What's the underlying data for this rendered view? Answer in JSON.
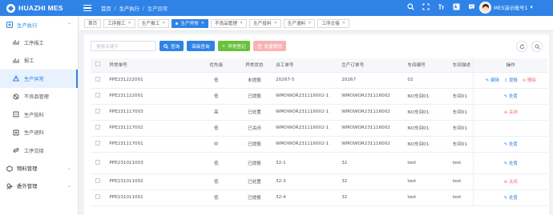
{
  "app": {
    "name": "HUAZHI MES"
  },
  "breadcrumb": [
    "首页",
    "生产执行",
    "生产异常"
  ],
  "header_icons": [
    "search-icon",
    "fullscreen-icon",
    "font-size-icon",
    "translate-icon",
    "message-icon"
  ],
  "user": {
    "name": "MES演示账号1",
    "dropdown": "▾"
  },
  "sidebar": {
    "group": {
      "label": "生产执行",
      "chev": "⌃"
    },
    "items": [
      {
        "label": "工序报工",
        "icon": "report-icon"
      },
      {
        "label": "报工",
        "icon": "report-icon"
      },
      {
        "label": "生产异常",
        "icon": "warning-icon",
        "active": true
      },
      {
        "label": "不良品管理",
        "icon": "bad-product-icon"
      },
      {
        "label": "生产投料",
        "icon": "feed-icon"
      },
      {
        "label": "生产退料",
        "icon": "return-icon"
      },
      {
        "label": "工序交接",
        "icon": "handover-icon"
      }
    ],
    "groups_after": [
      {
        "label": "物料管理",
        "chev": "⌄"
      },
      {
        "label": "委外管理",
        "chev": "⌄"
      }
    ]
  },
  "tabs": [
    {
      "label": "首页",
      "closable": false
    },
    {
      "label": "工序报工",
      "closable": true
    },
    {
      "label": "生产报工",
      "closable": true
    },
    {
      "label": "生产异常",
      "closable": true,
      "active": true
    },
    {
      "label": "不良品管理",
      "closable": true
    },
    {
      "label": "生产投料",
      "closable": true
    },
    {
      "label": "生产退料",
      "closable": true
    },
    {
      "label": "工序交接",
      "closable": true
    }
  ],
  "toolbar": {
    "search_placeholder": "搜索关键字",
    "query": "查询",
    "advanced": "高级查询",
    "add": "异常登记",
    "batch_delete": "批量删除"
  },
  "table": {
    "columns": [
      "异常单号",
      "优先级",
      "异常状态",
      "派工单号",
      "生产订单号",
      "车间编号",
      "车间描述",
      "操作"
    ],
    "rows": [
      {
        "no": "PPE231222001",
        "priority": "低",
        "status": "未提报",
        "dispatch": "20267-5",
        "order": "20267",
        "ws_no": "02",
        "ws_desc": "",
        "ops": [
          "编辑",
          "提报",
          "删除"
        ]
      },
      {
        "no": "PPE231122001",
        "priority": "低",
        "status": "已提报",
        "dispatch": "WMOWOR231116002-1",
        "order": "WMOWOR231116002",
        "ws_no": "NO车间01",
        "ws_desc": "车间01",
        "ops": [
          "处置"
        ]
      },
      {
        "no": "PPE231117003",
        "priority": "高",
        "status": "已处置",
        "dispatch": "WMOWOR231116002-1",
        "order": "WMOWOR231116002",
        "ws_no": "NO车间01",
        "ws_desc": "车间01",
        "ops": [
          "关闭"
        ]
      },
      {
        "no": "PPE231117002",
        "priority": "低",
        "status": "已关闭",
        "dispatch": "WMOWOR231116002-1",
        "order": "WMOWOR231116002",
        "ws_no": "NO车间01",
        "ws_desc": "车间01",
        "ops": []
      },
      {
        "no": "PPE231117001",
        "priority": "中",
        "status": "已提报",
        "dispatch": "WMOWOR231116002-1",
        "order": "WMOWOR231116002",
        "ws_no": "NO车间01",
        "ws_desc": "车间01",
        "ops": [
          "处置"
        ]
      },
      {
        "no": "PPE231011003",
        "priority": "低",
        "status": "已提报",
        "dispatch": "32-1",
        "order": "32",
        "ws_no": "test",
        "ws_desc": "test",
        "ops": [
          "处置"
        ],
        "tall": true
      },
      {
        "no": "PPE231011002",
        "priority": "低",
        "status": "已处置",
        "dispatch": "32-3",
        "order": "32",
        "ws_no": "test",
        "ws_desc": "test",
        "ops": [
          "关闭"
        ]
      },
      {
        "no": "PPE231011001",
        "priority": "低",
        "status": "已提报",
        "dispatch": "32-4",
        "order": "32",
        "ws_no": "test",
        "ws_desc": "test",
        "ops": [
          "处置"
        ]
      }
    ]
  },
  "colors": {
    "brand": "#2f83e6",
    "success": "#67c23a",
    "danger": "#f56c6c"
  }
}
